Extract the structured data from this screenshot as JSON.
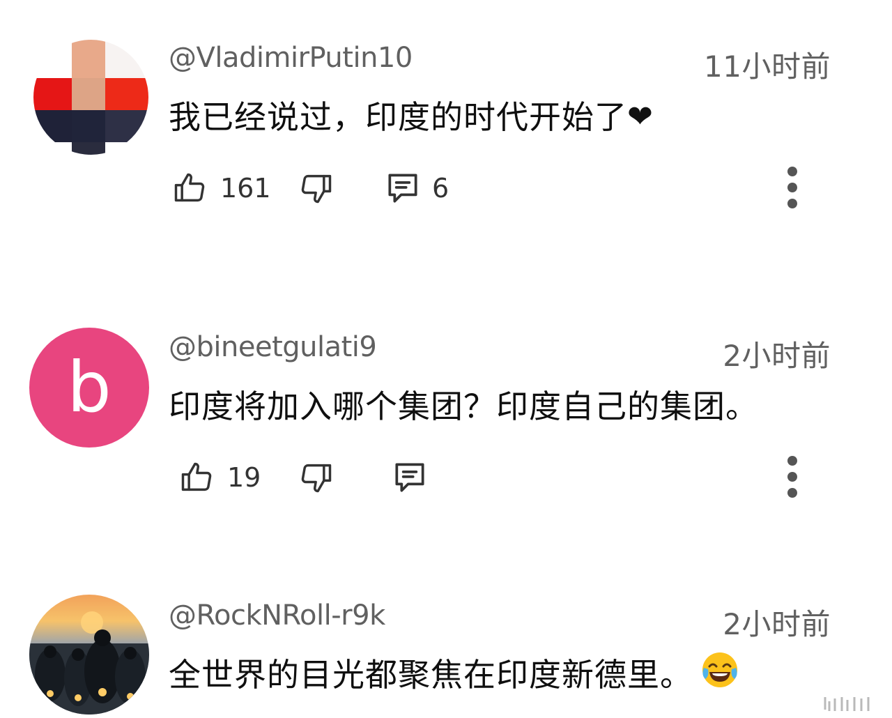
{
  "comments": [
    {
      "username": "@VladimirPutin10",
      "time": "11小时前",
      "text": "我已经说过，印度的时代开始了",
      "text_suffix": "❤",
      "likes": "161",
      "replies": "6",
      "avatar_type": "mosaic"
    },
    {
      "username": "@bineetgulati9",
      "time": "2小时前",
      "text": "印度将加入哪个集团？印度自己的集团。",
      "likes": "19",
      "replies": "",
      "avatar_letter": "b",
      "avatar_color": "#e8457f"
    },
    {
      "username": "@RockNRoll-r9k",
      "time": "2小时前",
      "text": "全世界的目光都聚焦在印度新德里。",
      "emoji": "joy-face-emoji",
      "avatar_type": "photo"
    }
  ],
  "colors": {
    "secondary_text": "#606060",
    "primary_text": "#0f0f0f",
    "icon": "#333333"
  }
}
